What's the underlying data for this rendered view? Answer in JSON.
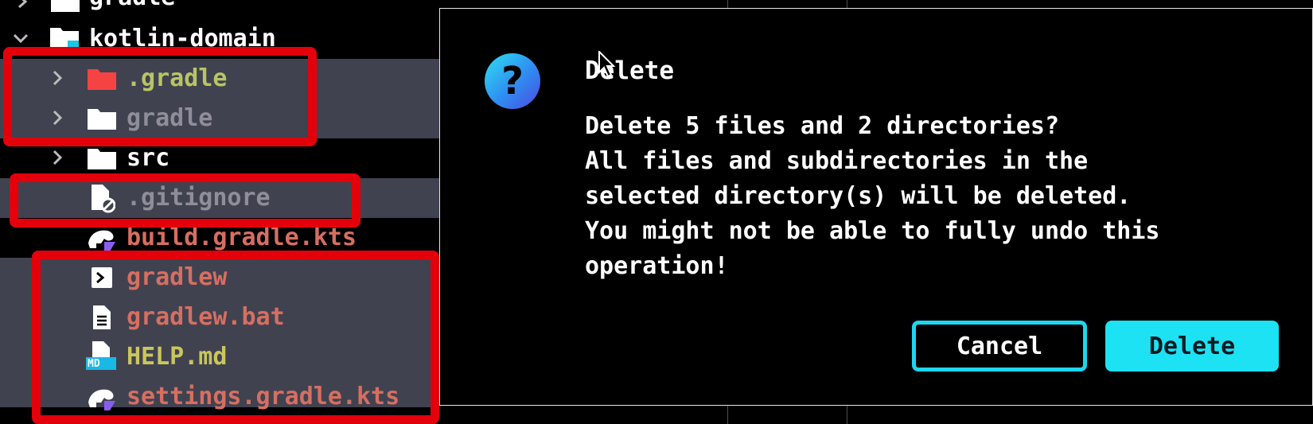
{
  "tree": {
    "items": [
      {
        "label": "gradle"
      },
      {
        "label": "kotlin-domain"
      },
      {
        "label": ".gradle"
      },
      {
        "label": "gradle"
      },
      {
        "label": "src"
      },
      {
        "label": ".gitignore"
      },
      {
        "label": "build.gradle.kts"
      },
      {
        "label": "gradlew"
      },
      {
        "label": "gradlew.bat"
      },
      {
        "label": "HELP.md"
      },
      {
        "label": "settings.gradle.kts"
      }
    ],
    "md_badge": "MD"
  },
  "dialog": {
    "icon": "?",
    "title": "Delete",
    "message_lines": [
      "Delete 5 files and 2 directories?",
      "All files and subdirectories in the",
      "selected directory(s) will be deleted.",
      "You might not be able to fully undo this",
      "operation!"
    ],
    "cancel_label": "Cancel",
    "delete_label": "Delete"
  },
  "colors": {
    "selection_bg": "#414250",
    "highlight_red": "#e3000b",
    "accent_cyan": "#1ce2f4"
  }
}
